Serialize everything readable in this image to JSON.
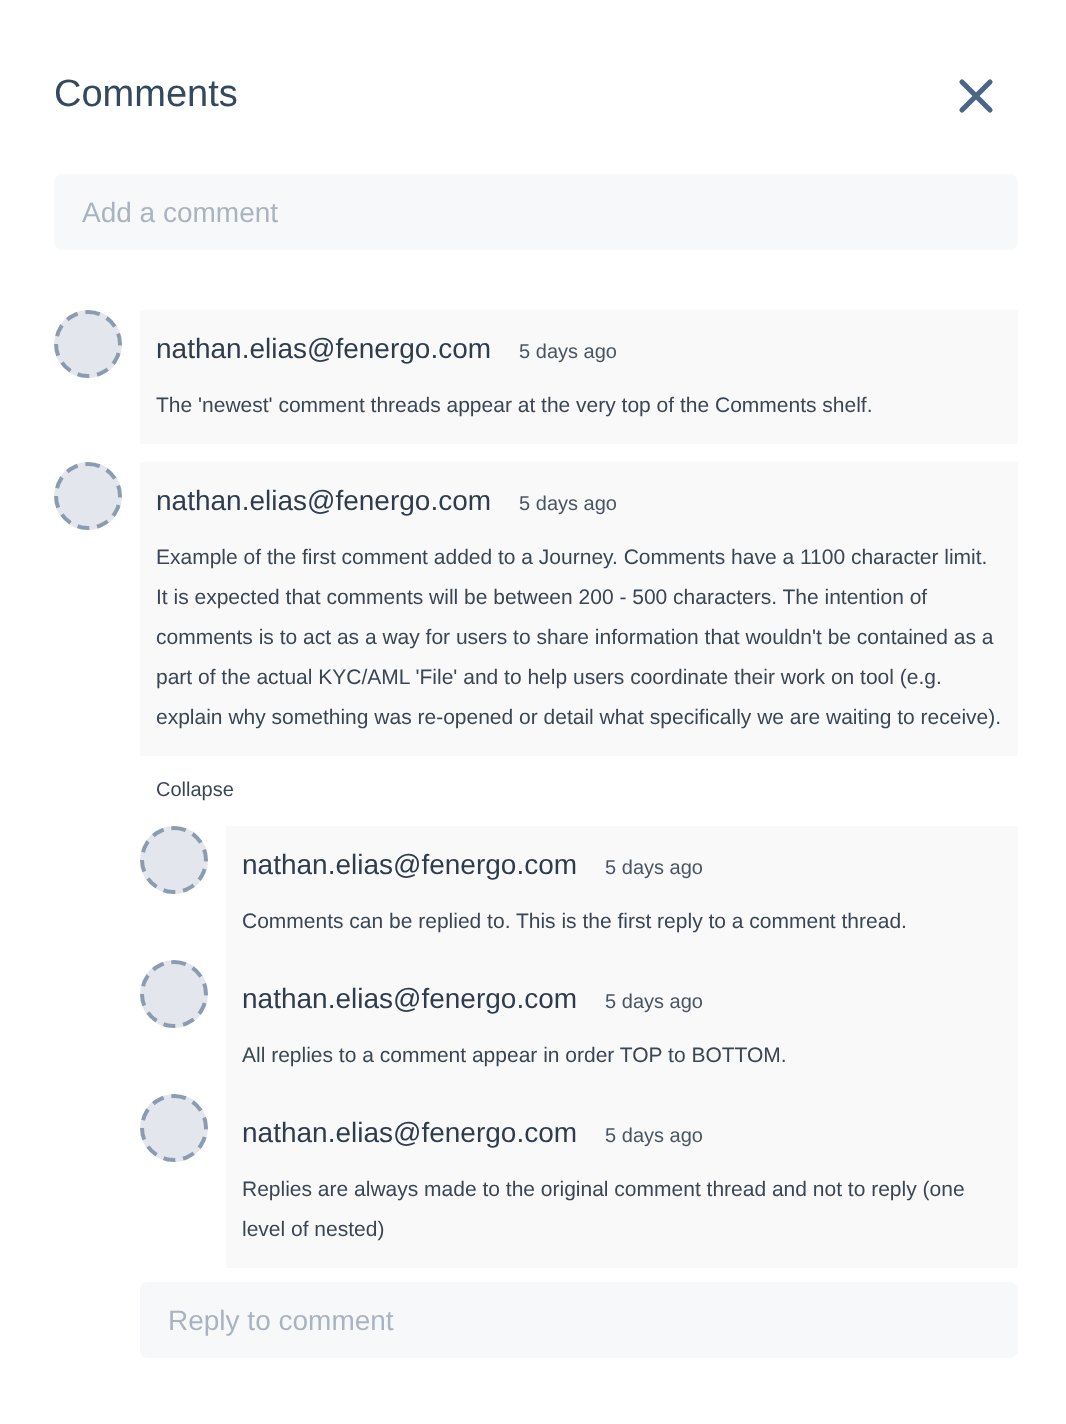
{
  "title": "Comments",
  "add_comment": {
    "placeholder": "Add a comment"
  },
  "threads": [
    {
      "author": "nathan.elias@fenergo.com",
      "time": "5 days ago",
      "text": "The 'newest' comment threads appear at the very top of the Comments shelf."
    },
    {
      "author": "nathan.elias@fenergo.com",
      "time": "5 days ago",
      "text": "Example of the first comment added to a Journey. Comments have a 1100 character limit. It is expected that comments will be between 200 - 500 characters. The intention of comments is to act as a way for users to share information that wouldn't be contained as a part of the actual KYC/AML 'File' and to help users coordinate their work on tool (e.g. explain why something was re-opened or detail what specifically we are waiting to receive).",
      "toggle_label": "Collapse",
      "replies": [
        {
          "author": "nathan.elias@fenergo.com",
          "time": "5 days ago",
          "text": "Comments can be replied to. This is the first reply to a comment thread."
        },
        {
          "author": "nathan.elias@fenergo.com",
          "time": "5 days ago",
          "text": "All replies to a comment appear in order TOP to BOTTOM."
        },
        {
          "author": "nathan.elias@fenergo.com",
          "time": "5 days ago",
          "text": "Replies are always made to the original comment thread and not to reply (one level of nested)"
        }
      ],
      "reply_field": {
        "placeholder": "Reply to comment"
      }
    }
  ]
}
